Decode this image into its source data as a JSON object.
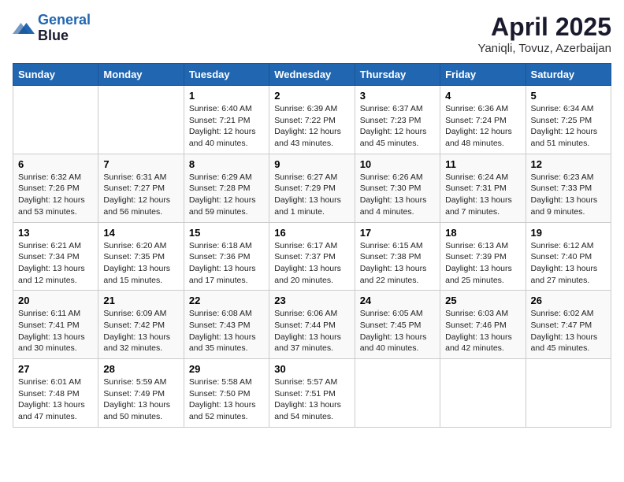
{
  "header": {
    "logo_line1": "General",
    "logo_line2": "Blue",
    "title": "April 2025",
    "subtitle": "Yaniqli, Tovuz, Azerbaijan"
  },
  "weekdays": [
    "Sunday",
    "Monday",
    "Tuesday",
    "Wednesday",
    "Thursday",
    "Friday",
    "Saturday"
  ],
  "weeks": [
    [
      {
        "day": "",
        "info": ""
      },
      {
        "day": "",
        "info": ""
      },
      {
        "day": "1",
        "info": "Sunrise: 6:40 AM\nSunset: 7:21 PM\nDaylight: 12 hours and 40 minutes."
      },
      {
        "day": "2",
        "info": "Sunrise: 6:39 AM\nSunset: 7:22 PM\nDaylight: 12 hours and 43 minutes."
      },
      {
        "day": "3",
        "info": "Sunrise: 6:37 AM\nSunset: 7:23 PM\nDaylight: 12 hours and 45 minutes."
      },
      {
        "day": "4",
        "info": "Sunrise: 6:36 AM\nSunset: 7:24 PM\nDaylight: 12 hours and 48 minutes."
      },
      {
        "day": "5",
        "info": "Sunrise: 6:34 AM\nSunset: 7:25 PM\nDaylight: 12 hours and 51 minutes."
      }
    ],
    [
      {
        "day": "6",
        "info": "Sunrise: 6:32 AM\nSunset: 7:26 PM\nDaylight: 12 hours and 53 minutes."
      },
      {
        "day": "7",
        "info": "Sunrise: 6:31 AM\nSunset: 7:27 PM\nDaylight: 12 hours and 56 minutes."
      },
      {
        "day": "8",
        "info": "Sunrise: 6:29 AM\nSunset: 7:28 PM\nDaylight: 12 hours and 59 minutes."
      },
      {
        "day": "9",
        "info": "Sunrise: 6:27 AM\nSunset: 7:29 PM\nDaylight: 13 hours and 1 minute."
      },
      {
        "day": "10",
        "info": "Sunrise: 6:26 AM\nSunset: 7:30 PM\nDaylight: 13 hours and 4 minutes."
      },
      {
        "day": "11",
        "info": "Sunrise: 6:24 AM\nSunset: 7:31 PM\nDaylight: 13 hours and 7 minutes."
      },
      {
        "day": "12",
        "info": "Sunrise: 6:23 AM\nSunset: 7:33 PM\nDaylight: 13 hours and 9 minutes."
      }
    ],
    [
      {
        "day": "13",
        "info": "Sunrise: 6:21 AM\nSunset: 7:34 PM\nDaylight: 13 hours and 12 minutes."
      },
      {
        "day": "14",
        "info": "Sunrise: 6:20 AM\nSunset: 7:35 PM\nDaylight: 13 hours and 15 minutes."
      },
      {
        "day": "15",
        "info": "Sunrise: 6:18 AM\nSunset: 7:36 PM\nDaylight: 13 hours and 17 minutes."
      },
      {
        "day": "16",
        "info": "Sunrise: 6:17 AM\nSunset: 7:37 PM\nDaylight: 13 hours and 20 minutes."
      },
      {
        "day": "17",
        "info": "Sunrise: 6:15 AM\nSunset: 7:38 PM\nDaylight: 13 hours and 22 minutes."
      },
      {
        "day": "18",
        "info": "Sunrise: 6:13 AM\nSunset: 7:39 PM\nDaylight: 13 hours and 25 minutes."
      },
      {
        "day": "19",
        "info": "Sunrise: 6:12 AM\nSunset: 7:40 PM\nDaylight: 13 hours and 27 minutes."
      }
    ],
    [
      {
        "day": "20",
        "info": "Sunrise: 6:11 AM\nSunset: 7:41 PM\nDaylight: 13 hours and 30 minutes."
      },
      {
        "day": "21",
        "info": "Sunrise: 6:09 AM\nSunset: 7:42 PM\nDaylight: 13 hours and 32 minutes."
      },
      {
        "day": "22",
        "info": "Sunrise: 6:08 AM\nSunset: 7:43 PM\nDaylight: 13 hours and 35 minutes."
      },
      {
        "day": "23",
        "info": "Sunrise: 6:06 AM\nSunset: 7:44 PM\nDaylight: 13 hours and 37 minutes."
      },
      {
        "day": "24",
        "info": "Sunrise: 6:05 AM\nSunset: 7:45 PM\nDaylight: 13 hours and 40 minutes."
      },
      {
        "day": "25",
        "info": "Sunrise: 6:03 AM\nSunset: 7:46 PM\nDaylight: 13 hours and 42 minutes."
      },
      {
        "day": "26",
        "info": "Sunrise: 6:02 AM\nSunset: 7:47 PM\nDaylight: 13 hours and 45 minutes."
      }
    ],
    [
      {
        "day": "27",
        "info": "Sunrise: 6:01 AM\nSunset: 7:48 PM\nDaylight: 13 hours and 47 minutes."
      },
      {
        "day": "28",
        "info": "Sunrise: 5:59 AM\nSunset: 7:49 PM\nDaylight: 13 hours and 50 minutes."
      },
      {
        "day": "29",
        "info": "Sunrise: 5:58 AM\nSunset: 7:50 PM\nDaylight: 13 hours and 52 minutes."
      },
      {
        "day": "30",
        "info": "Sunrise: 5:57 AM\nSunset: 7:51 PM\nDaylight: 13 hours and 54 minutes."
      },
      {
        "day": "",
        "info": ""
      },
      {
        "day": "",
        "info": ""
      },
      {
        "day": "",
        "info": ""
      }
    ]
  ]
}
